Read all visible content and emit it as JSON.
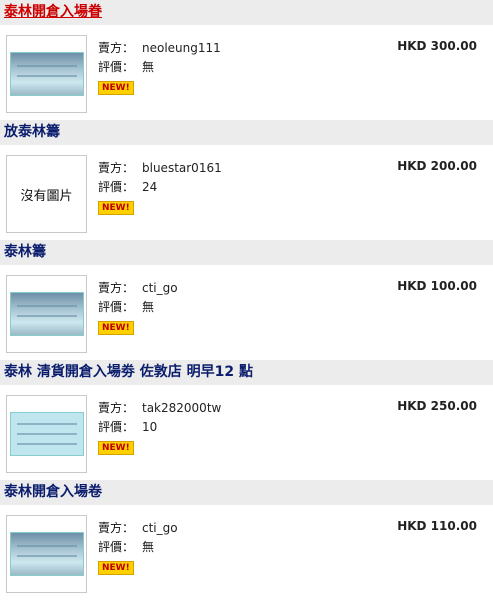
{
  "listings": [
    {
      "title": "泰林開倉入場眷",
      "seller_label": "賣方：",
      "seller": "neoleung111",
      "rating_label": "評價：",
      "rating": "無",
      "badge": "NEW!",
      "price": "HKD 300.00",
      "thumb": "ticket-dark",
      "highlight": true
    },
    {
      "title": "放泰林籌",
      "seller_label": "賣方：",
      "seller": "bluestar0161",
      "rating_label": "評價：",
      "rating": "24",
      "badge": "NEW!",
      "price": "HKD 200.00",
      "thumb": "none",
      "no_image_text": "沒有圖片",
      "highlight": false
    },
    {
      "title": "泰林籌",
      "seller_label": "賣方：",
      "seller": "cti_go",
      "rating_label": "評價：",
      "rating": "無",
      "badge": "NEW!",
      "price": "HKD 100.00",
      "thumb": "ticket-dark",
      "highlight": false
    },
    {
      "title": "泰林 清貨開倉入場劵 佐敦店 明早12 點",
      "seller_label": "賣方：",
      "seller": "tak282000tw",
      "rating_label": "評價：",
      "rating": "10",
      "badge": "NEW!",
      "price": "HKD 250.00",
      "thumb": "ticket-light",
      "highlight": false
    },
    {
      "title": "泰林開倉入場卷",
      "seller_label": "賣方：",
      "seller": "cti_go",
      "rating_label": "評價：",
      "rating": "無",
      "badge": "NEW!",
      "price": "HKD 110.00",
      "thumb": "ticket-dark",
      "highlight": false
    }
  ]
}
